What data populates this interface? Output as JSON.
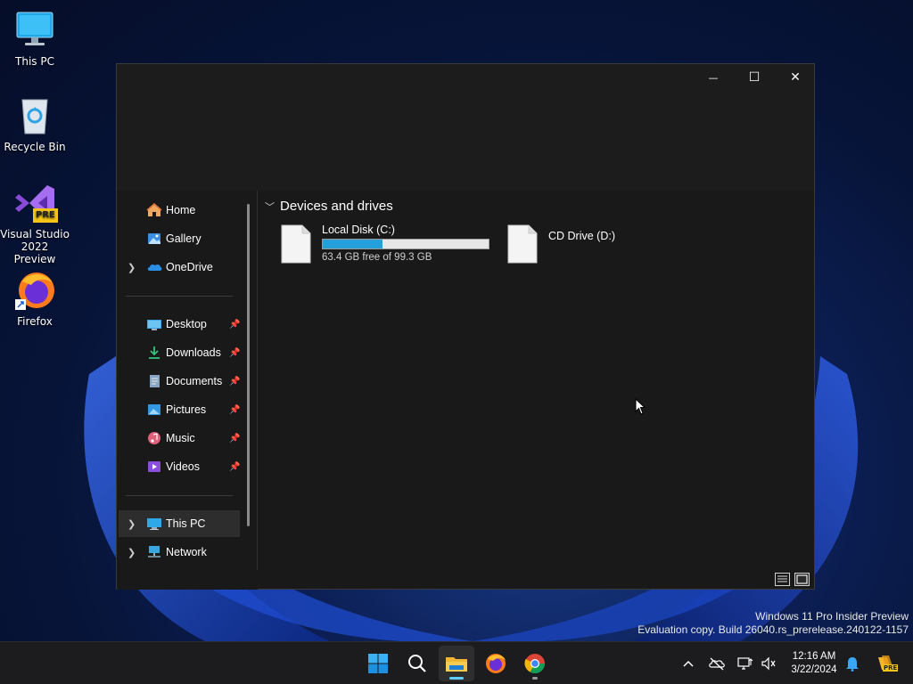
{
  "desktop": {
    "icons": [
      {
        "label": "This PC"
      },
      {
        "label": "Recycle Bin"
      },
      {
        "label": "Visual Studio 2022 Preview",
        "badge": "PRE"
      },
      {
        "label": "Firefox"
      }
    ]
  },
  "window": {
    "controls": {
      "minimize": "—",
      "maximize": "☐",
      "close": "✕"
    },
    "nav": {
      "top": [
        {
          "label": "Home",
          "icon": "home-icon"
        },
        {
          "label": "Gallery",
          "icon": "gallery-icon"
        },
        {
          "label": "OneDrive",
          "icon": "cloud-icon",
          "expandable": true
        }
      ],
      "quick": [
        {
          "label": "Desktop",
          "icon": "desktop-icon"
        },
        {
          "label": "Downloads",
          "icon": "download-icon"
        },
        {
          "label": "Documents",
          "icon": "document-icon"
        },
        {
          "label": "Pictures",
          "icon": "picture-icon"
        },
        {
          "label": "Music",
          "icon": "music-icon"
        },
        {
          "label": "Videos",
          "icon": "video-icon"
        }
      ],
      "bottom": [
        {
          "label": "This PC",
          "icon": "computer-icon",
          "selected": true
        },
        {
          "label": "Network",
          "icon": "network-icon"
        }
      ]
    },
    "content": {
      "group_title": "Devices and drives",
      "drives": [
        {
          "name": "Local Disk (C:)",
          "free_text": "63.4 GB free of 99.3 GB",
          "used_fraction": 0.36
        },
        {
          "name": "CD Drive (D:)"
        }
      ]
    }
  },
  "watermark": {
    "line1": "Windows 11 Pro Insider Preview",
    "line2": "Evaluation copy. Build 26040.rs_prerelease.240122-1157"
  },
  "taskbar": {
    "apps": [
      "start-icon",
      "search-icon",
      "file-explorer-icon",
      "firefox-icon",
      "chrome-icon"
    ],
    "clock": {
      "time": "12:16 AM",
      "date": "3/22/2024"
    },
    "tray_badge": "PRE"
  },
  "colors": {
    "accent": "#26a0da",
    "window_bg": "#191919",
    "taskbar_bg": "#1c1c1f"
  }
}
